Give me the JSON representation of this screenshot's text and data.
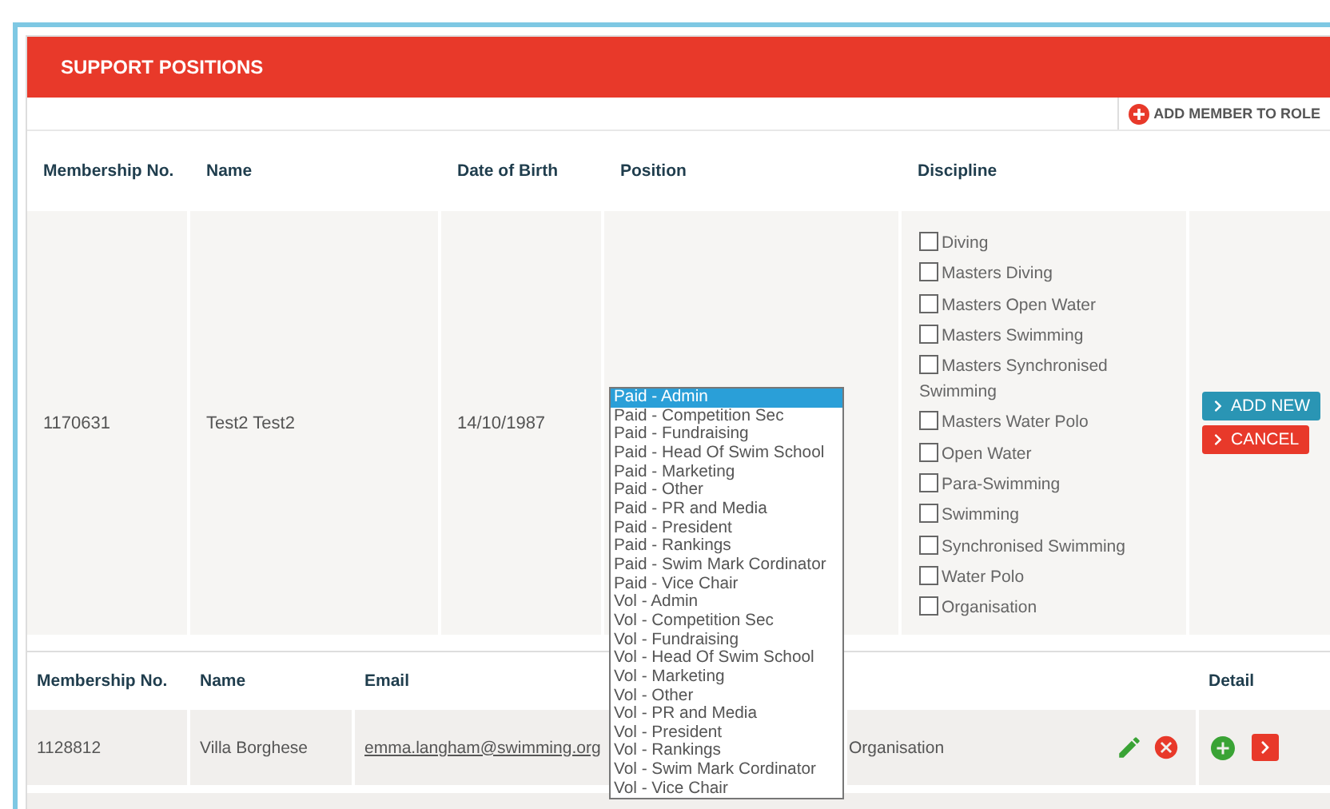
{
  "panel": {
    "title": "SUPPORT POSITIONS",
    "add_button": "ADD MEMBER TO ROLE"
  },
  "form_table": {
    "columns": [
      "Membership No.",
      "Name",
      "Date of Birth",
      "Position",
      "Discipline"
    ],
    "row": {
      "membership_no": "1170631",
      "name": "Test2 Test2",
      "dob": "14/10/1987"
    },
    "disciplines": [
      {
        "label": "Diving",
        "checked": false
      },
      {
        "label": "Masters Diving",
        "checked": false
      },
      {
        "label": "Masters Open Water",
        "checked": false
      },
      {
        "label": "Masters Swimming",
        "checked": false
      },
      {
        "label": "Masters Synchronised Swimming",
        "checked": false
      },
      {
        "label": "Masters Water Polo",
        "checked": false
      },
      {
        "label": "Open Water",
        "checked": false
      },
      {
        "label": "Para-Swimming",
        "checked": false
      },
      {
        "label": "Swimming",
        "checked": false
      },
      {
        "label": "Synchronised Swimming",
        "checked": false
      },
      {
        "label": "Water Polo",
        "checked": false
      },
      {
        "label": "Organisation",
        "checked": false
      }
    ],
    "buttons": [
      {
        "label": "ADD NEW",
        "kind": "primary"
      },
      {
        "label": "CANCEL",
        "kind": "danger"
      }
    ]
  },
  "position_dropdown": {
    "options": [
      {
        "label": "Paid - Admin",
        "selected": true
      },
      {
        "label": "Paid - Competition Sec",
        "selected": false
      },
      {
        "label": "Paid - Fundraising",
        "selected": false
      },
      {
        "label": "Paid - Head Of Swim School",
        "selected": false
      },
      {
        "label": "Paid - Marketing",
        "selected": false
      },
      {
        "label": "Paid - Other",
        "selected": false
      },
      {
        "label": "Paid - PR and Media",
        "selected": false
      },
      {
        "label": "Paid - President",
        "selected": false
      },
      {
        "label": "Paid - Rankings",
        "selected": false
      },
      {
        "label": "Paid - Swim Mark Cordinator",
        "selected": false
      },
      {
        "label": "Paid - Vice Chair",
        "selected": false
      },
      {
        "label": "Vol - Admin",
        "selected": false
      },
      {
        "label": "Vol - Competition Sec",
        "selected": false
      },
      {
        "label": "Vol - Fundraising",
        "selected": false
      },
      {
        "label": "Vol - Head Of Swim School",
        "selected": false
      },
      {
        "label": "Vol - Marketing",
        "selected": false
      },
      {
        "label": "Vol - Other",
        "selected": false
      },
      {
        "label": "Vol - PR and Media",
        "selected": false
      },
      {
        "label": "Vol - President",
        "selected": false
      },
      {
        "label": "Vol - Rankings",
        "selected": false
      },
      {
        "label": "Vol - Swim Mark Cordinator",
        "selected": false
      },
      {
        "label": "Vol - Vice Chair",
        "selected": false
      }
    ]
  },
  "members_table": {
    "columns": [
      "Membership No.",
      "Name",
      "Email",
      "Detail"
    ],
    "rows": [
      {
        "membership_no": "1128812",
        "name": "Villa Borghese",
        "email": "emma.langham@swimming.org",
        "discipline": "Organisation"
      }
    ]
  }
}
